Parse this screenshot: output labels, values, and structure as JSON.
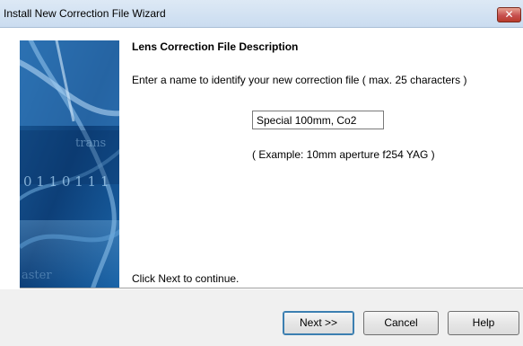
{
  "window": {
    "title": "Install New Correction File Wizard",
    "close_glyph": "✕"
  },
  "page": {
    "heading": "Lens Correction File Description",
    "instruction": "Enter a name to identify your new correction file ( max. 25 characters )",
    "name_value": "Special 100mm, Co2",
    "example": "( Example:  10mm aperture f254 YAG )",
    "continue_hint": "Click Next to continue."
  },
  "banner": {
    "digits": "0 1 1 0 1 1 1",
    "word": "trans",
    "word2": "aster",
    "colors": {
      "dark": "#0a3a6e",
      "mid": "#2a6aa8",
      "light": "#6fb0e0"
    }
  },
  "buttons": {
    "next": "Next >>",
    "cancel": "Cancel",
    "help": "Help"
  }
}
